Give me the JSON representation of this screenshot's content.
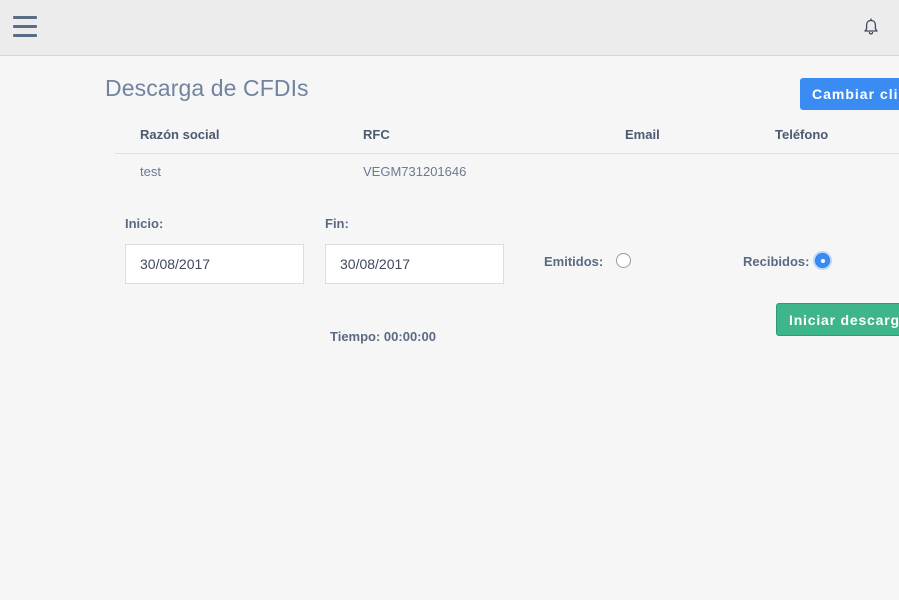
{
  "header": {
    "menu_icon": "hamburger-icon",
    "notification_icon": "bell-icon"
  },
  "page": {
    "title": "Descarga de CFDIs",
    "change_client_button": "Cambiar cliente"
  },
  "client_table": {
    "columns": [
      "Razón social",
      "RFC",
      "Email",
      "Teléfono"
    ],
    "rows": [
      {
        "razon_social": "test",
        "rfc": "VEGM731201646",
        "email": "",
        "telefono": ""
      }
    ]
  },
  "form": {
    "inicio_label": "Inicio:",
    "inicio_value": "30/08/2017",
    "fin_label": "Fin:",
    "fin_value": "30/08/2017",
    "emitidos_label": "Emitidos:",
    "emitidos_selected": false,
    "recibidos_label": "Recibidos:",
    "recibidos_selected": true,
    "start_download_button": "Iniciar descarga",
    "timer_text": "Tiempo: 00:00:00"
  },
  "colors": {
    "accent_blue": "#3b8cf2",
    "accent_green": "#3fb58b",
    "title_color": "#7283a0"
  }
}
